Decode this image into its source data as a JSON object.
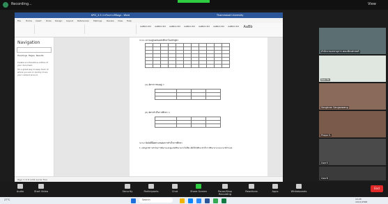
{
  "zoom": {
    "recording_label": "Recording...",
    "view_label": "View",
    "participants": [
      {
        "name": "สำนักงานเลขานุการ คณะศิลปศาสตร์"
      },
      {
        "name": "Nok Pa"
      },
      {
        "name": "Songkran Sangsawang"
      },
      {
        "name": "Prapa S."
      },
      {
        "name": "User5"
      },
      {
        "name": "User6"
      }
    ],
    "controls": [
      "Audio",
      "Start Video",
      "Security",
      "Participants",
      "Chat",
      "Share Screen",
      "Pause/Stop Recording",
      "Reactions",
      "Apps",
      "Whiteboards"
    ],
    "end_label": "End"
  },
  "word": {
    "title": "KPI2_3.3 การวิเคราะห์ข้อมูล - Word",
    "account": "Thammasat University",
    "tabs": [
      "File",
      "Home",
      "Insert",
      "Draw",
      "Design",
      "Layout",
      "References",
      "Mailings",
      "Review",
      "View",
      "Help"
    ],
    "styles": [
      "AaBbCcDd",
      "AaBbCcDd",
      "AaBbCcDd",
      "AaBbCcDd",
      "AaBbCcDd",
      "AaBbCcDd",
      "AaBbCcDd",
      "AaBb"
    ],
    "nav_title": "Navigation",
    "nav_search_placeholder": "Search document",
    "nav_tabs": [
      "Headings",
      "Pages",
      "Results"
    ],
    "nav_text1": "Create an interactive outline of your document.",
    "nav_text2": "It's a great way to keep track of where you are or quickly move your content around.",
    "doc_heading": "3.3.1 ความอยู่รอดของนักศึกษาในหลักสูตร",
    "doc_formula1": "(1) อัตราการคงอยู่ =",
    "doc_formula2": "(2) อัตราสำเร็จการศึกษา =",
    "doc_heading2": "3.3.2 ปัจจัยที่มีผลกระทบต่อการสำเร็จการศึกษา",
    "doc_para": "1. หลักสูตรมีการดำเนินการติดตามและดูแลนักศึกษาอย่างใกล้ชิด เพื่อให้นักศึกษาสำเร็จการศึกษาตามระยะเวลาที่กำหนด",
    "status": "Page 3 of 8   1234 words   Thai"
  },
  "taskbar": {
    "search": "Search",
    "weather": "27°C",
    "time": "10:28",
    "date": "10/11/2566"
  }
}
